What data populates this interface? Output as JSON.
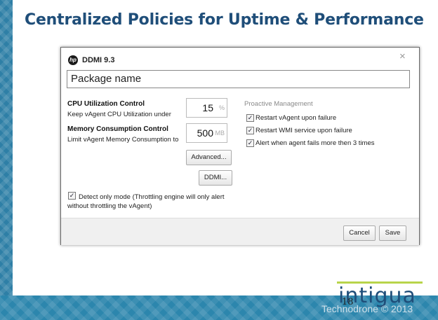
{
  "slide": {
    "title": "Centralized Policies for Uptime & Performance",
    "page_number": "18",
    "brand": "intigua",
    "copyright": "Technodrone © 2013"
  },
  "dialog": {
    "title": "DDMI 9.3",
    "close_glyph": "×",
    "package_name": "Package name",
    "cpu": {
      "heading": "CPU Utilization Control",
      "description": "Keep vAgent CPU Utilization under",
      "value": "15",
      "unit": "%"
    },
    "memory": {
      "heading": "Memory Consumption Control",
      "description": "Limit vAgent Memory Consumption to",
      "value": "500",
      "unit": "MB"
    },
    "advanced_label": "Advanced...",
    "ddmi_label": "DDMI...",
    "detect_only": {
      "checked": true,
      "label": "Detect only mode (Throttling engine will only alert without throttling the vAgent)"
    },
    "proactive": {
      "heading": "Proactive Management",
      "items": [
        {
          "label": "Restart vAgent upon failure",
          "checked": true
        },
        {
          "label": "Restart WMI service upon failure",
          "checked": true
        },
        {
          "label": "Alert when agent fails more then 3 times",
          "checked": true
        }
      ]
    },
    "cancel_label": "Cancel",
    "save_label": "Save"
  },
  "colors": {
    "title": "#1f4e79",
    "strip": "#2e7fa6",
    "brand_accent": "#b8d44a"
  },
  "icons": {
    "logo": "hp-logo-icon",
    "close": "close-icon",
    "checkbox": "checkmark-icon"
  }
}
